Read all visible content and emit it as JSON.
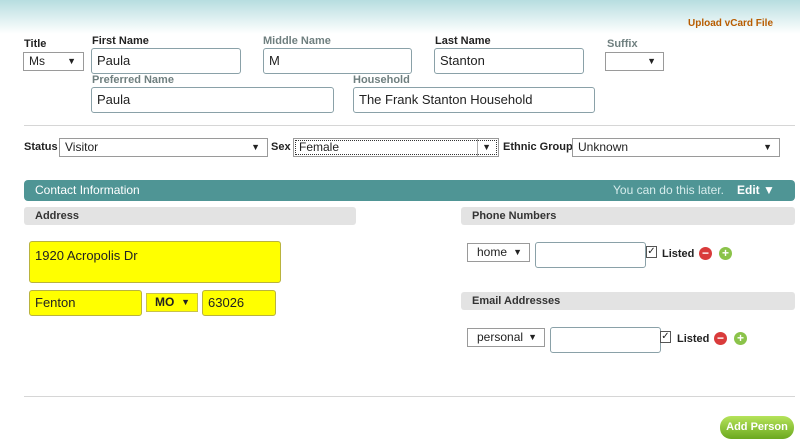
{
  "header": {
    "upload_vcard_label": "Upload vCard File"
  },
  "name_section": {
    "title": {
      "label": "Title",
      "value": "Ms"
    },
    "first_name": {
      "label": "First Name",
      "value": "Paula"
    },
    "middle_name": {
      "label": "Middle Name",
      "value": "M"
    },
    "last_name": {
      "label": "Last Name",
      "value": "Stanton"
    },
    "suffix": {
      "label": "Suffix",
      "value": ""
    },
    "preferred_name": {
      "label": "Preferred Name",
      "value": "Paula"
    },
    "household": {
      "label": "Household",
      "value": "The Frank Stanton Household"
    }
  },
  "demographics": {
    "status": {
      "label": "Status",
      "value": "Visitor"
    },
    "sex": {
      "label": "Sex",
      "value": "Female"
    },
    "ethnic_group": {
      "label": "Ethnic Group",
      "value": "Unknown"
    }
  },
  "contact": {
    "header_label": "Contact Information",
    "later_text": "You can do this later.",
    "edit_label": "Edit ▼",
    "address": {
      "section_label": "Address",
      "street": "1920 Acropolis Dr",
      "city": "Fenton",
      "state": "MO",
      "zip": "63026"
    },
    "phone": {
      "section_label": "Phone Numbers",
      "type": "home",
      "number": "",
      "listed_label": "Listed"
    },
    "email": {
      "section_label": "Email Addresses",
      "type": "personal",
      "address": "",
      "listed_label": "Listed"
    }
  },
  "footer": {
    "add_person_label": "Add Person"
  },
  "colors": {
    "accent_teal": "#4f9595",
    "highlight_yellow": "#ffff00",
    "add_green": "#7ab52a",
    "remove_red": "#d93b3b",
    "upload_link": "#b85c00"
  }
}
